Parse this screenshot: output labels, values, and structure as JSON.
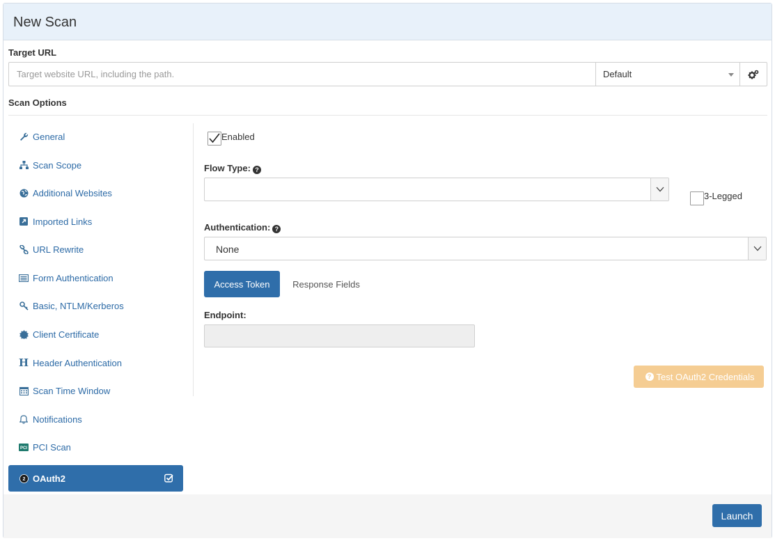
{
  "header": {
    "title": "New Scan"
  },
  "target": {
    "label": "Target URL",
    "placeholder": "Target website URL, including the path.",
    "profile": "Default",
    "settings_icon": "gears-icon"
  },
  "scan_options": {
    "label": "Scan Options"
  },
  "sidebar": {
    "items": [
      {
        "label": "General",
        "icon": "wrench-icon"
      },
      {
        "label": "Scan Scope",
        "icon": "sitemap-icon"
      },
      {
        "label": "Additional Websites",
        "icon": "globe-icon"
      },
      {
        "label": "Imported Links",
        "icon": "external-link-icon"
      },
      {
        "label": "URL Rewrite",
        "icon": "link-icon"
      },
      {
        "label": "Form Authentication",
        "icon": "list-icon"
      },
      {
        "label": "Basic, NTLM/Kerberos",
        "icon": "key-icon"
      },
      {
        "label": "Client Certificate",
        "icon": "certificate-icon"
      },
      {
        "label": "Header Authentication",
        "icon": "header-icon"
      },
      {
        "label": "Scan Time Window",
        "icon": "calendar-icon"
      },
      {
        "label": "Notifications",
        "icon": "bell-icon"
      },
      {
        "label": "PCI Scan",
        "icon": "pci-icon"
      },
      {
        "label": "OAuth2",
        "icon": "oauth2-icon",
        "active": true
      }
    ]
  },
  "oauth": {
    "enabled_label": "Enabled",
    "enabled_checked": true,
    "flow_type_label": "Flow Type:",
    "flow_type_value": "",
    "three_legged_label": "3-Legged",
    "three_legged_checked": false,
    "authentication_label": "Authentication:",
    "authentication_value": "None",
    "tabs": [
      {
        "label": "Access Token",
        "active": true
      },
      {
        "label": "Response Fields",
        "active": false
      }
    ],
    "endpoint_label": "Endpoint:",
    "endpoint_value": "",
    "test_button": "Test OAuth2 Credentials"
  },
  "footer": {
    "launch": "Launch"
  },
  "colors": {
    "primary": "#2f6eaa",
    "link": "#2c6aa6",
    "header_bg": "#e8f1fa",
    "warning_disabled": "#f5cd93"
  }
}
